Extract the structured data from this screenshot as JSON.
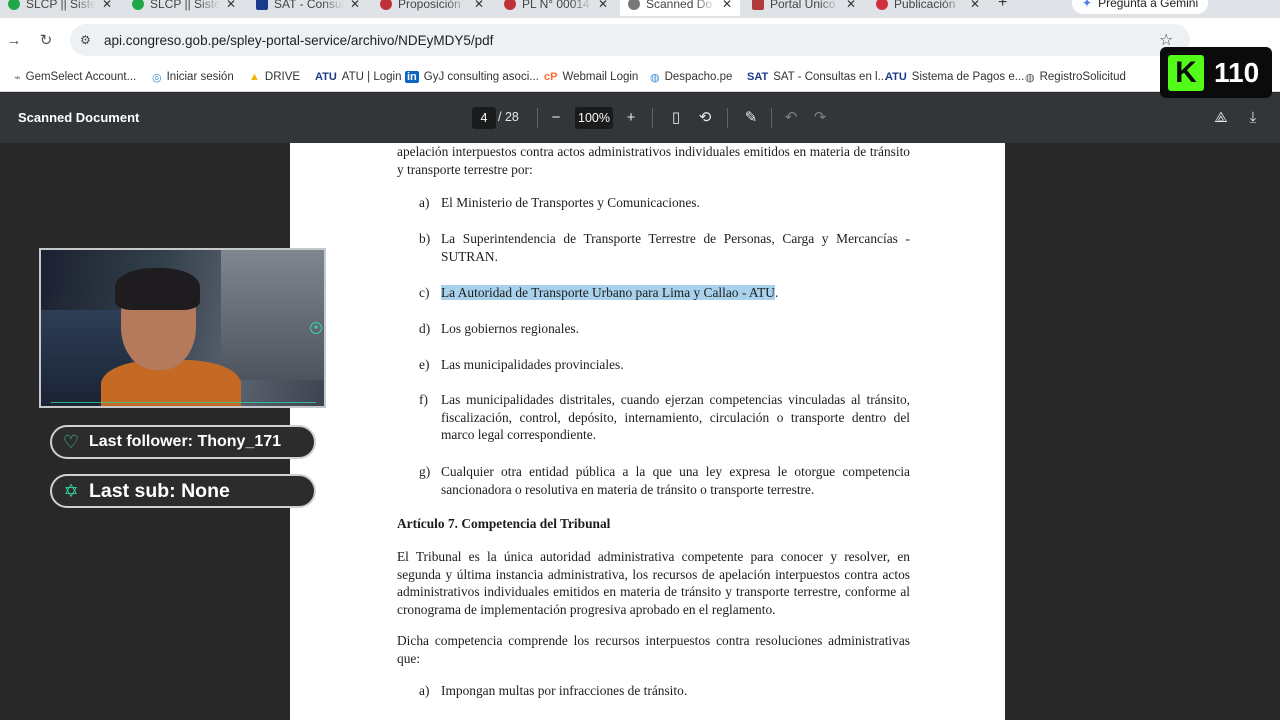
{
  "tabs": [
    {
      "label": "SLCP || Siste",
      "icon": "check-icon",
      "color": "#1fa84a",
      "active": false
    },
    {
      "label": "SLCP || Siste",
      "icon": "check-icon",
      "color": "#1fa84a",
      "active": false
    },
    {
      "label": "SAT - Consult",
      "icon": "sat-icon",
      "color": "#1b3a8c",
      "active": false
    },
    {
      "label": "Proposición",
      "icon": "congress-icon",
      "color": "#c0303a",
      "active": false
    },
    {
      "label": "PL N° 00014",
      "icon": "congress-icon",
      "color": "#c0303a",
      "active": false
    },
    {
      "label": "Scanned Do",
      "icon": "globe-icon",
      "color": "#555555",
      "active": true
    },
    {
      "label": "Portal Único",
      "icon": "portal-icon",
      "color": "#b33a3a",
      "active": false
    },
    {
      "label": "Publicación",
      "icon": "pub-icon",
      "color": "#d0303a",
      "active": false
    }
  ],
  "gemini_label": "Pregunta a Gemini",
  "address": {
    "url": "api.congreso.gob.pe/spley-portal-service/archivo/NDEyMDY5/pdf"
  },
  "bookmarks": [
    {
      "label": "GemSelect Account...",
      "icon": "bird-icon"
    },
    {
      "label": "Iniciar sesión",
      "icon": "swirl-icon"
    },
    {
      "label": "DRIVE",
      "icon": "drive-icon"
    },
    {
      "label": "ATU | Login",
      "icon": "atu-icon"
    },
    {
      "label": "GyJ consulting asoci...",
      "icon": "linkedin-icon"
    },
    {
      "label": "Webmail Login",
      "icon": "cp-icon"
    },
    {
      "label": "Despacho.pe",
      "icon": "globe-icon"
    },
    {
      "label": "SAT - Consultas en l...",
      "icon": "sat-icon"
    },
    {
      "label": "Sistema de Pagos e...",
      "icon": "atu-icon"
    },
    {
      "label": "RegistroSolicitud",
      "icon": "globe-icon"
    }
  ],
  "pdf": {
    "title": "Scanned Document",
    "page": "4",
    "total": "/ 28",
    "zoom": "100%"
  },
  "doc": {
    "intro": "apelación interpuestos contra actos administrativos individuales emitidos en materia de tránsito y transporte terrestre por:",
    "items1": [
      {
        "mark": "a)",
        "text": "El Ministerio de Transportes y Comunicaciones."
      },
      {
        "mark": "b)",
        "text": "La Superintendencia de Transporte Terrestre de Personas, Carga y Mercancías - SUTRAN."
      },
      {
        "mark": "c)",
        "text": "La Autoridad de Transporte Urbano para Lima y Callao - ATU",
        "trail": "."
      },
      {
        "mark": "d)",
        "text": "Los gobiernos regionales."
      },
      {
        "mark": "e)",
        "text": "Las municipalidades provinciales."
      },
      {
        "mark": "f)",
        "text": "Las municipalidades distritales, cuando ejerzan competencias vinculadas al tránsito, fiscalización, control, depósito, internamiento, circulación o transporte dentro del marco legal correspondiente."
      },
      {
        "mark": "g)",
        "text": "Cualquier otra entidad pública a la que una ley expresa le otorgue competencia sancionadora o resolutiva en materia de tránsito o transporte terrestre."
      }
    ],
    "article_heading": "Artículo 7. Competencia del Tribunal",
    "article_p1": "El Tribunal es la única autoridad administrativa competente para conocer y resolver, en segunda y última instancia administrativa, los recursos de apelación interpuestos contra actos administrativos individuales emitidos en materia de tránsito y transporte terrestre, conforme al cronograma de implementación progresiva aprobado en el reglamento.",
    "article_p2": "Dicha competencia comprende los recursos interpuestos contra resoluciones administrativas que:",
    "items2": [
      {
        "mark": "a)",
        "text": "Impongan multas por infracciones de tránsito."
      }
    ]
  },
  "overlay": {
    "last_follower": "Last follower: Thony_171",
    "last_sub": "Last sub: None",
    "counter": "110",
    "counter_logo": "K",
    "accent": "#35d3a3",
    "kick_green": "#53fc18"
  }
}
